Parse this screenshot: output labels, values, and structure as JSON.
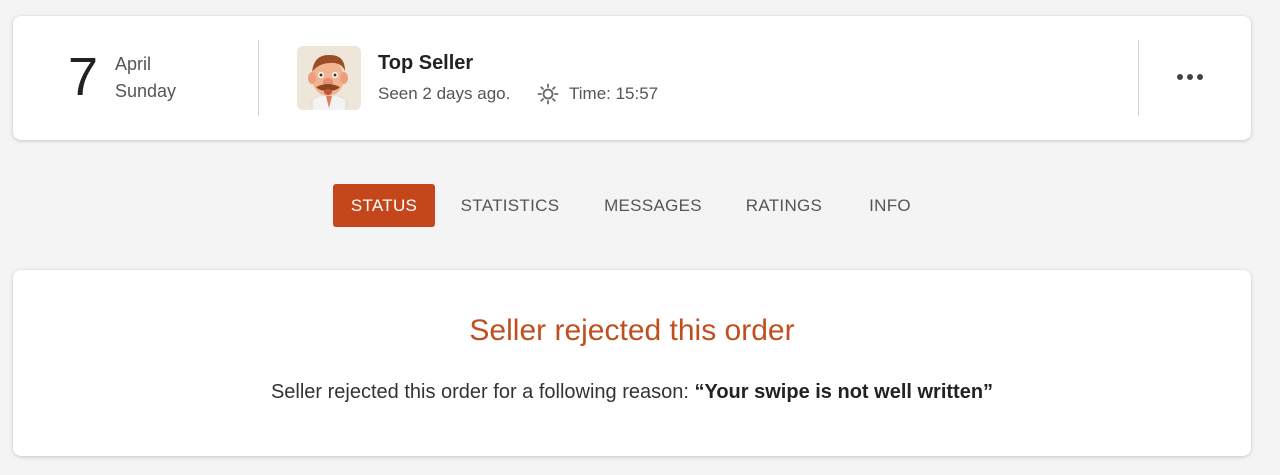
{
  "header": {
    "day": "7",
    "month": "April",
    "weekday": "Sunday",
    "seller_name": "Top Seller",
    "seen": "Seen 2 days ago.",
    "time": "Time: 15:57",
    "icons": {
      "avatar": "seller-avatar",
      "weather": "sun-icon",
      "menu": "more-options-icon"
    }
  },
  "tabs": [
    {
      "label": "STATUS",
      "active": true
    },
    {
      "label": "STATISTICS",
      "active": false
    },
    {
      "label": "MESSAGES",
      "active": false
    },
    {
      "label": "RATINGS",
      "active": false
    },
    {
      "label": "INFO",
      "active": false
    }
  ],
  "status": {
    "title": "Seller rejected this order",
    "reason_prefix": "Seller rejected this order for a following reason: ",
    "reason": "“Your swipe is not well written”"
  },
  "colors": {
    "accent": "#c4461b",
    "title": "#bf4f1f",
    "background": "#f4f4f4"
  }
}
